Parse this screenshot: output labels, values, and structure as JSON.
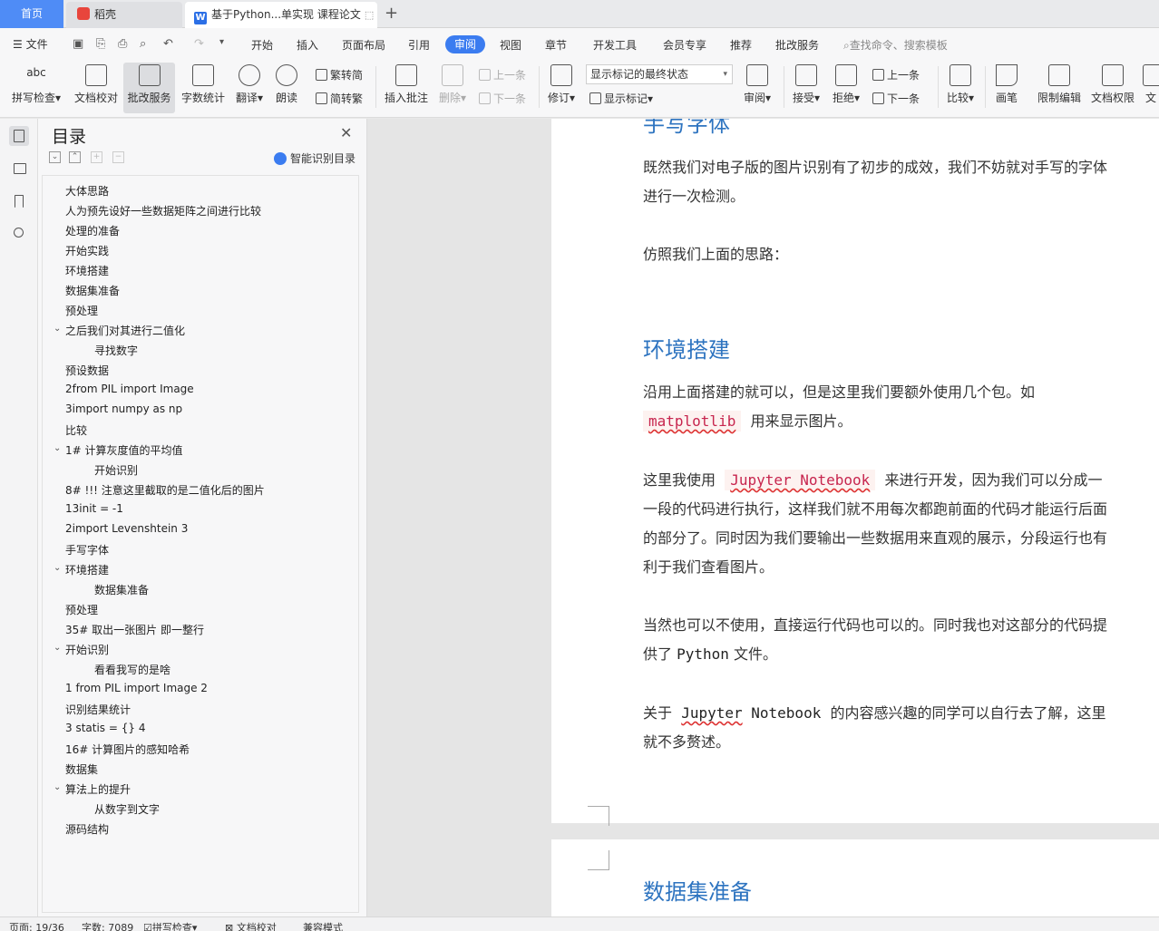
{
  "titlebar": {
    "home_tab": "首页",
    "daoke_tab": "稻壳",
    "doc_tab": "基于Python...单实现 课程论文"
  },
  "menubar": {
    "file": "文件",
    "items": [
      "开始",
      "插入",
      "页面布局",
      "引用",
      "审阅",
      "视图",
      "章节",
      "开发工具",
      "会员专享",
      "推荐",
      "批改服务"
    ],
    "active": "审阅",
    "search": "查找命令、搜索模板"
  },
  "ribbon": {
    "spell_check": "拼写检查",
    "doc_proof": "文档校对",
    "correction_service": "批改服务",
    "word_count": "字数统计",
    "translate": "翻译",
    "read_aloud": "朗读",
    "to_traditional": "繁转简",
    "to_simplified": "简转繁",
    "insert_comment": "插入批注",
    "delete": "删除",
    "prev": "上一条",
    "next": "下一条",
    "track_changes": "修订",
    "markup_select": "显示标记的最终状态",
    "show_markup": "显示标记",
    "review": "审阅",
    "accept": "接受",
    "reject": "拒绝",
    "prev2": "上一条",
    "next2": "下一条",
    "compare": "比较",
    "pen": "画笔",
    "restrict_edit": "限制编辑",
    "doc_rights": "文档权限",
    "doc_cut": "文"
  },
  "toc": {
    "title": "目录",
    "ai_label": "智能识别目录",
    "items": [
      {
        "text": "大体思路",
        "level": 1,
        "chev": false
      },
      {
        "text": "人为预先设好一些数据矩阵之间进行比较",
        "level": 1,
        "chev": false
      },
      {
        "text": "处理的准备",
        "level": 1,
        "chev": false
      },
      {
        "text": "开始实践",
        "level": 1,
        "chev": false
      },
      {
        "text": "环境搭建",
        "level": 1,
        "chev": false
      },
      {
        "text": "数据集准备",
        "level": 1,
        "chev": false
      },
      {
        "text": "预处理",
        "level": 1,
        "chev": false
      },
      {
        "text": "之后我们对其进行二值化",
        "level": 1,
        "chev": true
      },
      {
        "text": "寻找数字",
        "level": 2,
        "chev": false
      },
      {
        "text": "预设数据",
        "level": 1,
        "chev": false
      },
      {
        "text": "2from  PIL  import  Image",
        "level": 1,
        "chev": false
      },
      {
        "text": "3import  numpy  as  np",
        "level": 1,
        "chev": false
      },
      {
        "text": "比较",
        "level": 1,
        "chev": false
      },
      {
        "text": "1# 计算灰度值的平均值",
        "level": 1,
        "chev": true
      },
      {
        "text": "开始识别",
        "level": 2,
        "chev": false
      },
      {
        "text": "8# !!! 注意这里截取的是二值化后的图片",
        "level": 1,
        "chev": false
      },
      {
        "text": "13init  =  -1",
        "level": 1,
        "chev": false
      },
      {
        "text": "2import  Levenshtein 3",
        "level": 1,
        "chev": false
      },
      {
        "text": "手写字体",
        "level": 1,
        "chev": false
      },
      {
        "text": "环境搭建",
        "level": 1,
        "chev": true
      },
      {
        "text": "数据集准备",
        "level": 2,
        "chev": false
      },
      {
        "text": "预处理",
        "level": 1,
        "chev": false
      },
      {
        "text": "35# 取出一张图片 即一整行",
        "level": 1,
        "chev": false
      },
      {
        "text": "开始识别",
        "level": 1,
        "chev": true
      },
      {
        "text": "看看我写的是啥",
        "level": 2,
        "chev": false
      },
      {
        "text": "1 from  PIL  import  Image 2",
        "level": 1,
        "chev": false
      },
      {
        "text": "识别结果统计",
        "level": 1,
        "chev": false
      },
      {
        "text": "3 statis = {} 4",
        "level": 1,
        "chev": false
      },
      {
        "text": "16# 计算图片的感知哈希",
        "level": 1,
        "chev": false
      },
      {
        "text": "数据集",
        "level": 1,
        "chev": false
      },
      {
        "text": "算法上的提升",
        "level": 1,
        "chev": true
      },
      {
        "text": "从数字到文字",
        "level": 2,
        "chev": false
      },
      {
        "text": "源码结构",
        "level": 1,
        "chev": false
      }
    ]
  },
  "doc": {
    "heading_top": "手写字体",
    "p1_line1": "既然我们对电子版的图片识别有了初步的成效，我们不妨就对手写的字体",
    "p1_line2": "进行一次检测。",
    "p2": "仿照我们上面的思路：",
    "heading_env": "环境搭建",
    "p3_line1": "沿用上面搭建的就可以，但是这里我们要额外使用几个包。如",
    "p3_code": "matplotlib",
    "p3_line2_rest": "用来显示图片。",
    "p4_pre": "这里我使用",
    "p4_code": "Jupyter Notebook",
    "p4_post": "来进行开发，因为我们可以分成一",
    "p4_line2": "一段的代码进行执行，这样我们就不用每次都跑前面的代码才能运行后面",
    "p4_line3": "的部分了。同时因为我们要输出一些数据用来直观的展示，分段运行也有",
    "p4_line4": "利于我们查看图片。",
    "p5_line1": "当然也可以不使用，直接运行代码也可以的。同时我也对这部分的代码提",
    "p5_line2_pre": "供了",
    "p5_python": "Python",
    "p5_line2_post": "文件。",
    "p6_pre": "关于",
    "p6_code_a": "Jupyter",
    "p6_code_b": "Notebook",
    "p6_post": "的内容感兴趣的同学可以自行去了解，这里",
    "p6_line2": "就不多赘述。",
    "heading_data": "数据集准备"
  },
  "status": {
    "page": "页面: 19/36",
    "words": "字数: 7089",
    "spell": "拼写检查",
    "proof": "文档校对",
    "compat": "兼容模式"
  },
  "colors": {
    "accent": "#3b7cf0",
    "heading": "#2e74c0",
    "code_red": "#c7254e"
  }
}
